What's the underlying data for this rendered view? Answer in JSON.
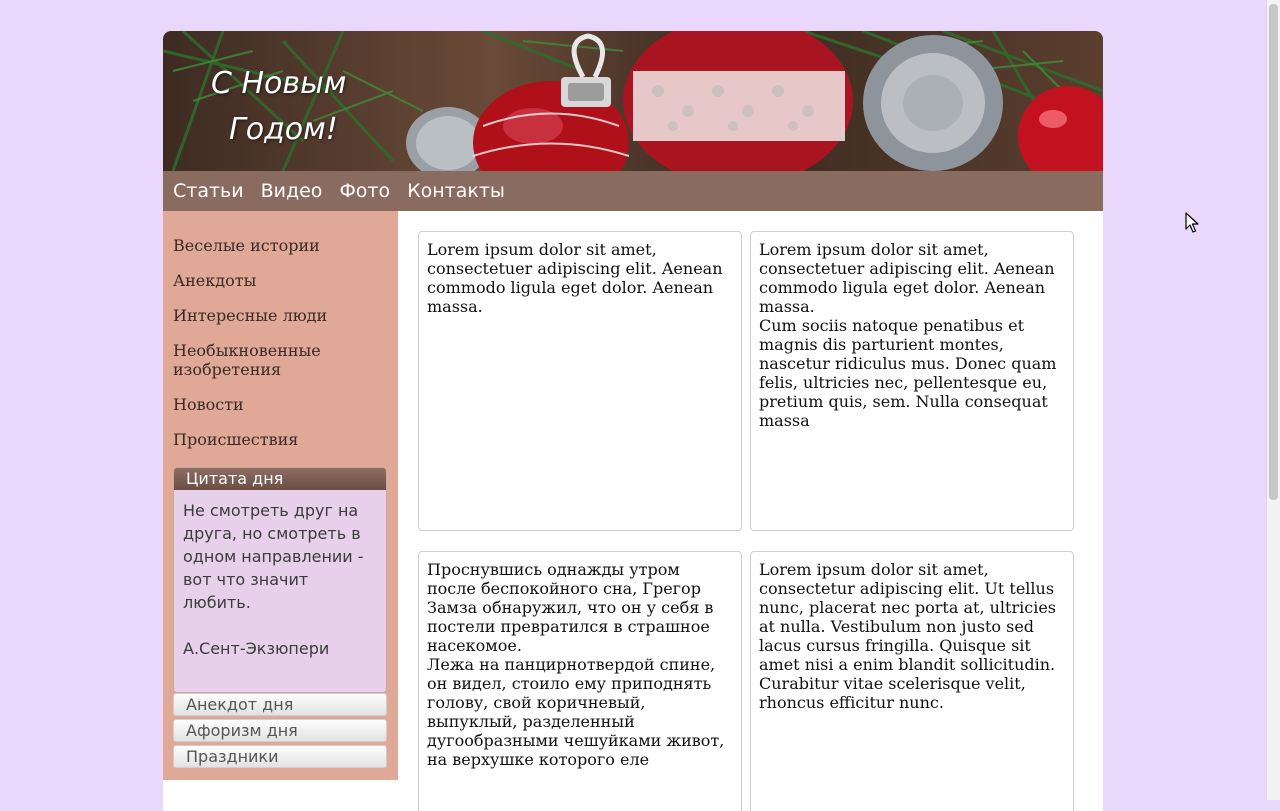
{
  "banner": {
    "title_line1": "С Новым",
    "title_line2": "Годом!"
  },
  "nav": [
    "Статьи",
    "Видео",
    "Фото",
    "Контакты"
  ],
  "sidebar": {
    "links": [
      "Веселые истории",
      "Анекдоты",
      "Интересные люди",
      "Необыкновенные изобретения",
      "Новости",
      "Происшествия"
    ],
    "quote": {
      "title": "Цитата дня",
      "text": "Не смотреть друг на друга, но смотреть в одном направлении - вот что значит любить.",
      "author": "А.Сент-Экзюпери"
    },
    "accordion": [
      "Анекдот дня",
      "Афоризм дня",
      "Праздники"
    ]
  },
  "cards": [
    {
      "paragraphs": [
        "Lorem ipsum dolor sit amet, consectetuer adipiscing elit. Aenean commodo ligula eget dolor. Aenean massa."
      ]
    },
    {
      "paragraphs": [
        "Lorem ipsum dolor sit amet, consectetuer adipiscing elit. Aenean commodo ligula eget dolor. Aenean massa.",
        "Cum sociis natoque penatibus et magnis dis parturient montes, nascetur ridiculus mus. Donec quam felis, ultricies nec, pellentesque eu, pretium quis, sem. Nulla consequat massa"
      ]
    },
    {
      "paragraphs": [
        "Проснувшись однажды утром после беспокойного сна, Грегор Замза обнаружил, что он у себя в постели превратился в страшное насекомое.",
        "Лежа на панцирнотвердой спине, он видел, стоило ему приподнять голову, свой коричневый, выпуклый, разделенный дугообразными чешуйками живот, на верхушке которого еле"
      ]
    },
    {
      "paragraphs": [
        "Lorem ipsum dolor sit amet, consectetur adipiscing elit. Ut tellus nunc, placerat nec porta at, ultricies at nulla. Vestibulum non justo sed lacus cursus fringilla. Quisque sit amet nisi a enim blandit sollicitudin. Curabitur vitae scelerisque velit, rhoncus efficitur nunc."
      ]
    }
  ],
  "icons": {
    "cursor": "mouse-pointer-icon"
  },
  "colors": {
    "background": "#e9d8fb",
    "nav": "#8a6b5f",
    "sidebar": "#dfa897",
    "quote_panel": "#e6d0ea"
  }
}
